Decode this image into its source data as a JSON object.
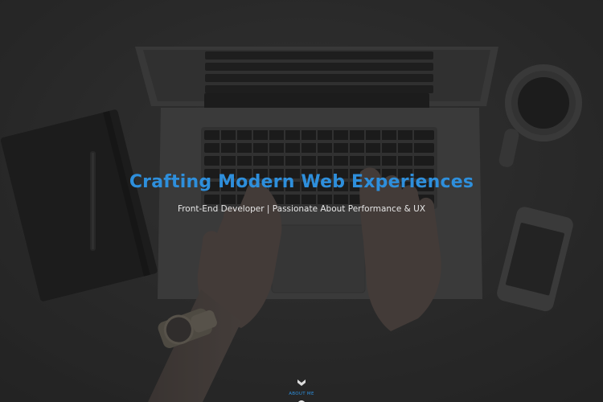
{
  "hero": {
    "title": "Crafting Modern Web Experiences",
    "subtitle": "Front-End Developer | Passionate About Performance & UX",
    "scroll_label": "ABOUT ME"
  },
  "colors": {
    "title": "#2e8fdc",
    "subtitle": "#e6e6e6",
    "scroll": "#2e8fdc",
    "overlay": "#2b2b2b"
  },
  "icons": {
    "scroll": "chevron-down-icon"
  }
}
